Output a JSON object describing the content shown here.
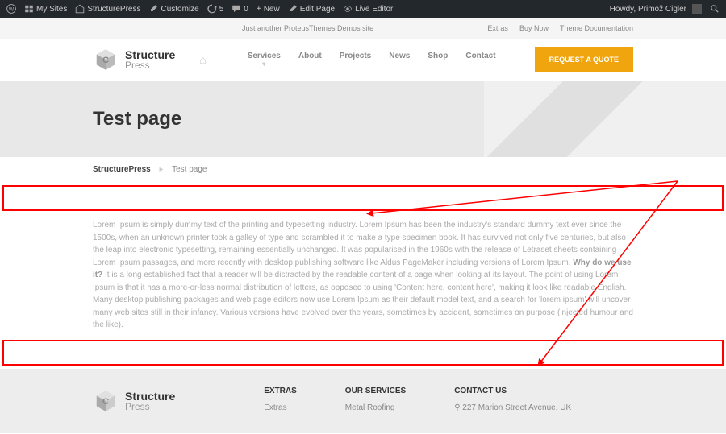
{
  "admin": {
    "mysites": "My Sites",
    "sitename": "StructurePress",
    "customize": "Customize",
    "updates": "5",
    "comments": "0",
    "new": "New",
    "editpage": "Edit Page",
    "liveeditor": "Live Editor",
    "howdy": "Howdy, Primož Cigler"
  },
  "topbar": {
    "tagline": "Just another ProteusThemes Demos site",
    "links": [
      "Extras",
      "Buy Now",
      "Theme Documentation"
    ]
  },
  "logo": {
    "line1": "Structure",
    "line2": "Press"
  },
  "nav": [
    "Services",
    "About",
    "Projects",
    "News",
    "Shop",
    "Contact"
  ],
  "quote": "REQUEST A QUOTE",
  "hero": {
    "title": "Test page"
  },
  "crumbs": {
    "home": "StructurePress",
    "current": "Test page"
  },
  "content": {
    "p1": "Lorem Ipsum is simply dummy text of the printing and typesetting industry. Lorem Ipsum has been the industry's standard dummy text ever since the 1500s, when an unknown printer took a galley of type and scrambled it to make a type specimen book. It has survived not only five centuries, but also the leap into electronic typesetting, remaining essentially unchanged. It was popularised in the 1960s with the release of Letraset sheets containing Lorem Ipsum passages, and more recently with desktop publishing software like Aldus PageMaker including versions of Lorem Ipsum.",
    "p2b": "Why do we use it?",
    "p2": " It is a long established fact that a reader will be distracted by the readable content of a page when looking at its layout. The point of using Lorem Ipsum is that it has a more-or-less normal distribution of letters, as opposed to using 'Content here, content here', making it look like readable English. Many desktop publishing packages and web page editors now use Lorem Ipsum as their default model text, and a search for 'lorem ipsum' will uncover many web sites still in their infancy. Various versions have evolved over the years, sometimes by accident, sometimes on purpose (injected humour and the like)."
  },
  "footer": {
    "extras": {
      "title": "EXTRAS",
      "items": [
        "Extras"
      ]
    },
    "services": {
      "title": "OUR SERVICES",
      "items": [
        "Metal Roofing"
      ]
    },
    "contact": {
      "title": "CONTACT US",
      "addr": "227 Marion Street Avenue, UK"
    }
  }
}
